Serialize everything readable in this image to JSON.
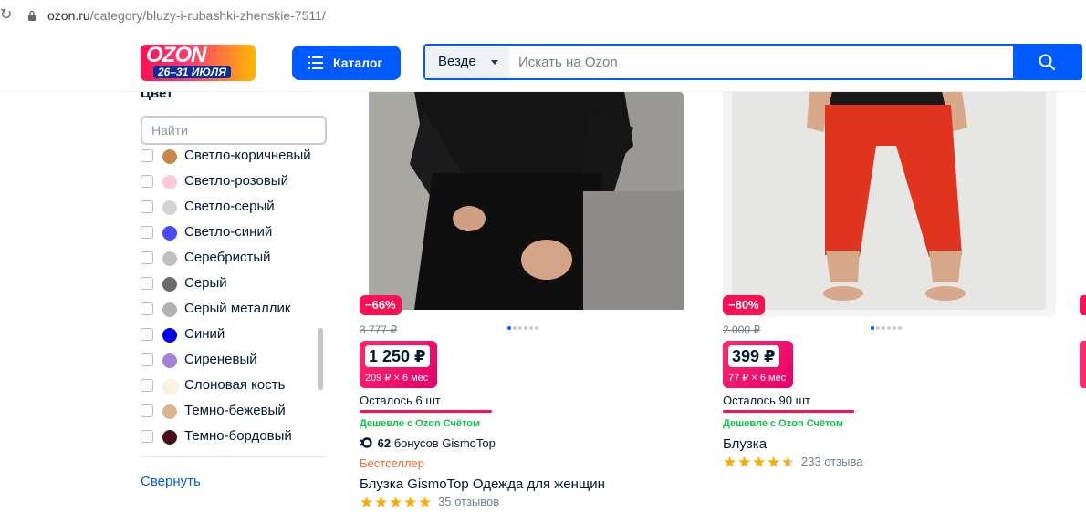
{
  "browser": {
    "url_host": "ozon.ru",
    "url_path": "/category/bluzy-i-rubashki-zhenskie-7511/"
  },
  "header": {
    "logo_text": "OZON",
    "logo_dates": "26–31 ИЮЛЯ",
    "catalog_label": "Каталог",
    "search_scope": "Везде",
    "search_placeholder": "Искать на Ozon",
    "colors": {
      "brand_blue": "#005bff",
      "promo_pink": "#f91155"
    }
  },
  "sidebar": {
    "title": "Цвет",
    "find_placeholder": "Найти",
    "colors": [
      {
        "label": "Светло-коричневый",
        "swatch": "#c9874a"
      },
      {
        "label": "Светло-розовый",
        "swatch": "#ffc8dd"
      },
      {
        "label": "Светло-серый",
        "swatch": "#d3d3d3"
      },
      {
        "label": "Светло-синий",
        "swatch": "#4a4aff"
      },
      {
        "label": "Серебристый",
        "swatch": "#c0c0c0"
      },
      {
        "label": "Серый",
        "swatch": "#6b6b6b"
      },
      {
        "label": "Серый металлик",
        "swatch": "#b3b3b3"
      },
      {
        "label": "Синий",
        "swatch": "#0000ee"
      },
      {
        "label": "Сиреневый",
        "swatch": "#a384d9"
      },
      {
        "label": "Слоновая кость",
        "swatch": "#fdf3e2"
      },
      {
        "label": "Темно-бежевый",
        "swatch": "#d9b48f"
      },
      {
        "label": "Темно-бордовый",
        "swatch": "#4a0f14"
      }
    ],
    "collapse_label": "Свернуть"
  },
  "products": [
    {
      "discount": "−66%",
      "old_price": "3 777 ₽",
      "price": "1 250 ₽",
      "installment": "209 ₽ × 6 мес",
      "stock_text": "Осталось 6 шт",
      "stock_fraction": 0.98,
      "cheaper_label": "Дешевле с Ozon Счётом",
      "bonus_count": "62",
      "bonus_text": "бонусов GismoTop",
      "badge": "Бестселлер",
      "name": "Блузка GismoTop Одежда для женщин",
      "rating": 5,
      "reviews": "35 отзывов"
    },
    {
      "discount": "−80%",
      "old_price": "2 000 ₽",
      "price": "399 ₽",
      "installment": "77 ₽ × 6 мес",
      "stock_text": "Осталось 90 шт",
      "stock_fraction": 0.97,
      "cheaper_label": "Дешевле с Ozon Счётом",
      "name": "Блузка",
      "rating": 4.5,
      "reviews": "233 отзыва"
    }
  ]
}
